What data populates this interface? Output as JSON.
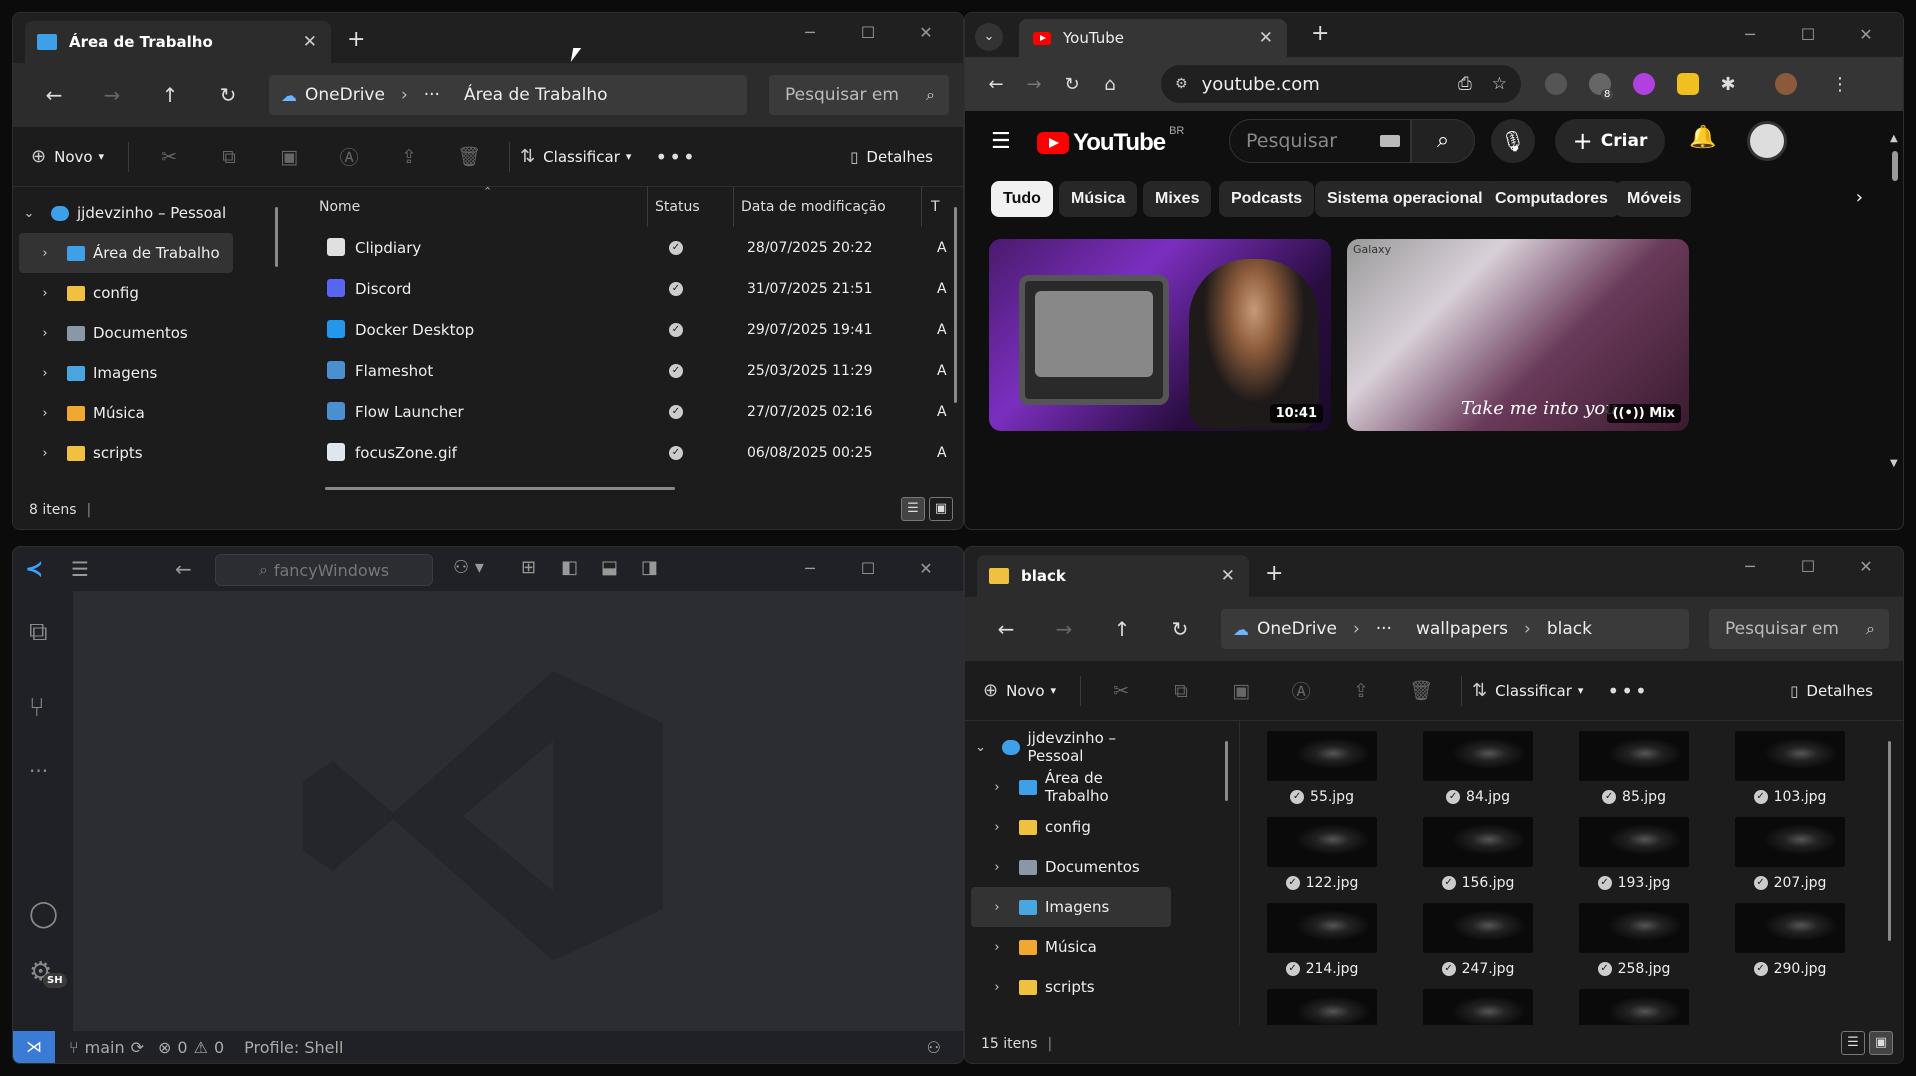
{
  "explorer_top": {
    "tab_title": "Área de Trabalho",
    "breadcrumb": [
      "OneDrive",
      "···",
      "Área de Trabalho"
    ],
    "search_placeholder": "Pesquisar em",
    "cmd": {
      "new": "Novo",
      "sort": "Classificar",
      "details": "Detalhes"
    },
    "tree": [
      {
        "label": "jjdevzinho – Pessoal",
        "icon": "cloud-icon",
        "expanded": true
      },
      {
        "label": "Área de Trabalho",
        "icon": "desktop-folder-icon",
        "selected": true
      },
      {
        "label": "config",
        "icon": "folder-icon"
      },
      {
        "label": "Documentos",
        "icon": "documents-icon"
      },
      {
        "label": "Imagens",
        "icon": "pictures-icon"
      },
      {
        "label": "Música",
        "icon": "music-folder-icon"
      },
      {
        "label": "scripts",
        "icon": "folder-icon"
      }
    ],
    "columns": [
      "Nome",
      "Status",
      "Data de modificação",
      "T"
    ],
    "files": [
      {
        "name": "Clipdiary",
        "date": "28/07/2025 20:22",
        "type": "A"
      },
      {
        "name": "Discord",
        "date": "31/07/2025 21:51",
        "type": "A"
      },
      {
        "name": "Docker Desktop",
        "date": "29/07/2025 19:41",
        "type": "A"
      },
      {
        "name": "Flameshot",
        "date": "25/03/2025 11:29",
        "type": "A"
      },
      {
        "name": "Flow Launcher",
        "date": "27/07/2025 02:16",
        "type": "A"
      },
      {
        "name": "focusZone.gif",
        "date": "06/08/2025 00:25",
        "type": "A"
      }
    ],
    "status": "8 itens"
  },
  "youtube": {
    "tab_title": "YouTube",
    "url": "youtube.com",
    "brand": "YouTube",
    "region": "BR",
    "search_placeholder": "Pesquisar",
    "create_label": "Criar",
    "extension_badge": "8",
    "chips": [
      "Tudo",
      "Música",
      "Mixes",
      "Podcasts",
      "Sistema operacional",
      "Computadores",
      "Móveis"
    ],
    "videos": [
      {
        "badge": "10:41"
      },
      {
        "badge": "Mix",
        "caption": "Take me into you",
        "corner_text": "Galaxy"
      }
    ]
  },
  "vscode": {
    "command_center": "fancyWindows",
    "branch": "main",
    "errors": "0",
    "warnings": "0",
    "profile": "Profile: Shell",
    "account_badge": "SH"
  },
  "explorer_bottom": {
    "tab_title": "black",
    "breadcrumb": [
      "OneDrive",
      "···",
      "wallpapers",
      "black"
    ],
    "search_placeholder": "Pesquisar em",
    "cmd": {
      "new": "Novo",
      "sort": "Classificar",
      "details": "Detalhes"
    },
    "tree": [
      {
        "label": "jjdevzinho – Pessoal",
        "icon": "cloud-icon",
        "expanded": true
      },
      {
        "label": "Área de Trabalho",
        "icon": "desktop-folder-icon"
      },
      {
        "label": "config",
        "icon": "folder-icon"
      },
      {
        "label": "Documentos",
        "icon": "documents-icon"
      },
      {
        "label": "Imagens",
        "icon": "pictures-icon",
        "selected": true
      },
      {
        "label": "Música",
        "icon": "music-folder-icon"
      },
      {
        "label": "scripts",
        "icon": "folder-icon"
      }
    ],
    "thumbs": [
      "55.jpg",
      "84.jpg",
      "85.jpg",
      "103.jpg",
      "122.jpg",
      "156.jpg",
      "193.jpg",
      "207.jpg",
      "214.jpg",
      "247.jpg",
      "258.jpg",
      "290.jpg",
      "",
      "",
      ""
    ],
    "status": "15 itens"
  },
  "colors": {
    "youtube_red": "#ff0000",
    "vscode_blue": "#3a7bd5",
    "onedrive_blue": "#6cb5ff"
  }
}
